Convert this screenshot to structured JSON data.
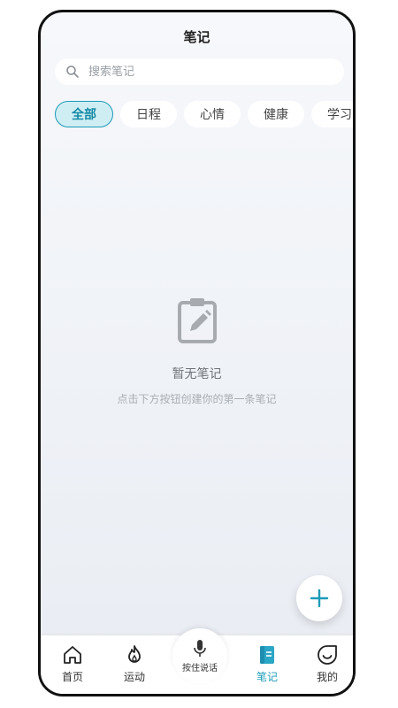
{
  "header": {
    "title": "笔记"
  },
  "search": {
    "placeholder": "搜索笔记",
    "value": ""
  },
  "categories": [
    "全部",
    "日程",
    "心情",
    "健康",
    "学习"
  ],
  "active_category": "全部",
  "empty_state": {
    "title": "暂无笔记",
    "subtitle": "点击下方按钮创建你的第一条笔记",
    "icon": "clipboard-edit-icon"
  },
  "fab": {
    "icon": "plus-icon"
  },
  "tabs": {
    "home": {
      "label": "首页",
      "icon": "home-icon"
    },
    "sport": {
      "label": "运动",
      "icon": "flame-icon"
    },
    "voice": {
      "label": "按住说话",
      "icon": "microphone-icon"
    },
    "notes": {
      "label": "笔记",
      "icon": "notebook-icon"
    },
    "mine": {
      "label": "我的",
      "icon": "smile-icon"
    }
  },
  "colors": {
    "accent": "#1e9bb8",
    "chip_active_bg": "#cfeef4",
    "text_muted": "#a9aeb4"
  }
}
